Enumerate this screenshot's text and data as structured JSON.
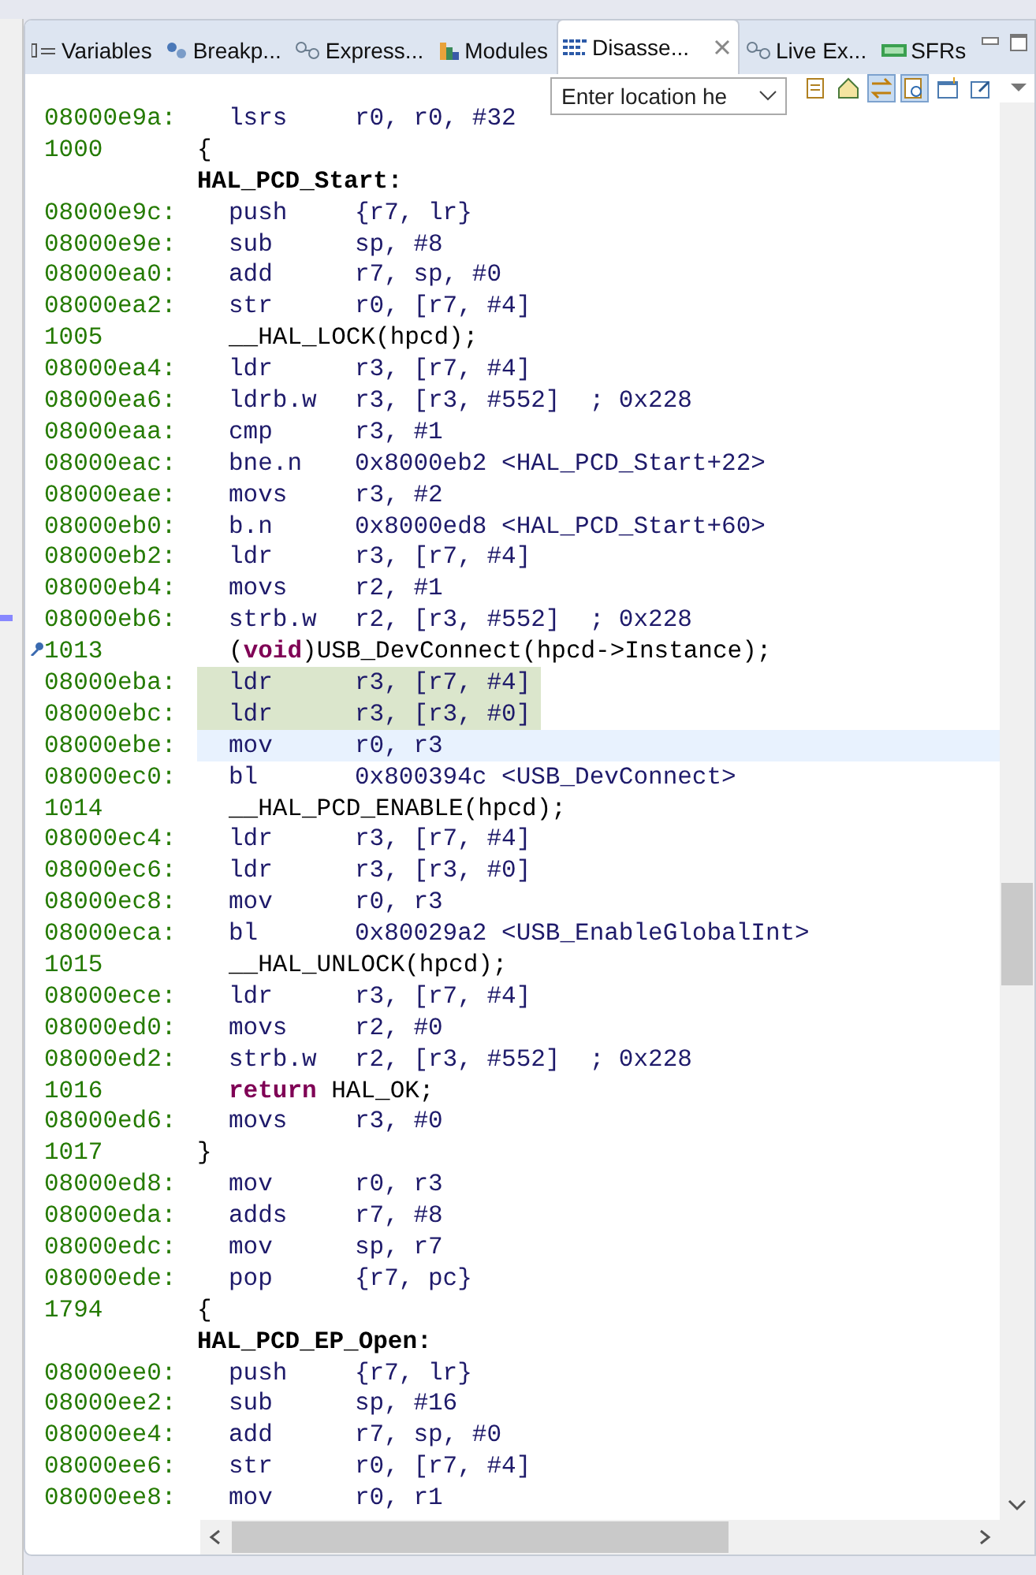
{
  "tabs": [
    {
      "label": "Variables",
      "kind": "variables",
      "selected": false
    },
    {
      "label": "Breakp...",
      "kind": "breakpoints",
      "selected": false
    },
    {
      "label": "Express...",
      "kind": "expressions",
      "selected": false
    },
    {
      "label": "Modules",
      "kind": "modules",
      "selected": false
    },
    {
      "label": "Disasse...",
      "kind": "disassembly",
      "selected": true
    },
    {
      "label": "Live Ex...",
      "kind": "live",
      "selected": false
    },
    {
      "label": "SFRs",
      "kind": "sfr",
      "selected": false
    }
  ],
  "location": {
    "placeholder": "Enter location he"
  },
  "toolbar_buttons": [
    {
      "kind": "document",
      "pressed": false
    },
    {
      "kind": "home",
      "pressed": false
    },
    {
      "kind": "swap",
      "pressed": true
    },
    {
      "kind": "link",
      "pressed": true
    },
    {
      "kind": "new-window",
      "pressed": false
    },
    {
      "kind": "pin",
      "pressed": false
    }
  ],
  "lines": [
    {
      "kind": "instr",
      "address": "08000e9a:",
      "mnemonic": "lsrs",
      "operands": "r0, r0, #32",
      "highlighted": false,
      "current": false
    },
    {
      "kind": "source",
      "number": "1000",
      "text": "{",
      "indented": false,
      "breakpoint": false
    },
    {
      "kind": "label",
      "text": "HAL_PCD_Start:"
    },
    {
      "kind": "instr",
      "address": "08000e9c:",
      "mnemonic": "push",
      "operands": "{r7, lr}",
      "highlighted": false,
      "current": false
    },
    {
      "kind": "instr",
      "address": "08000e9e:",
      "mnemonic": "sub",
      "operands": "sp, #8",
      "highlighted": false,
      "current": false
    },
    {
      "kind": "instr",
      "address": "08000ea0:",
      "mnemonic": "add",
      "operands": "r7, sp, #0",
      "highlighted": false,
      "current": false
    },
    {
      "kind": "instr",
      "address": "08000ea2:",
      "mnemonic": "str",
      "operands": "r0, [r7, #4]",
      "highlighted": false,
      "current": false
    },
    {
      "kind": "source",
      "number": "1005",
      "text": "__HAL_LOCK(hpcd);",
      "indented": true,
      "breakpoint": false
    },
    {
      "kind": "instr",
      "address": "08000ea4:",
      "mnemonic": "ldr",
      "operands": "r3, [r7, #4]",
      "highlighted": false,
      "current": false
    },
    {
      "kind": "instr",
      "address": "08000ea6:",
      "mnemonic": "ldrb.w",
      "operands": "r3, [r3, #552]  ; 0x228",
      "highlighted": false,
      "current": false
    },
    {
      "kind": "instr",
      "address": "08000eaa:",
      "mnemonic": "cmp",
      "operands": "r3, #1",
      "highlighted": false,
      "current": false
    },
    {
      "kind": "instr",
      "address": "08000eac:",
      "mnemonic": "bne.n",
      "operands": "0x8000eb2 <HAL_PCD_Start+22>",
      "highlighted": false,
      "current": false
    },
    {
      "kind": "instr",
      "address": "08000eae:",
      "mnemonic": "movs",
      "operands": "r3, #2",
      "highlighted": false,
      "current": false
    },
    {
      "kind": "instr",
      "address": "08000eb0:",
      "mnemonic": "b.n",
      "operands": "0x8000ed8 <HAL_PCD_Start+60>",
      "highlighted": false,
      "current": false
    },
    {
      "kind": "instr",
      "address": "08000eb2:",
      "mnemonic": "ldr",
      "operands": "r3, [r7, #4]",
      "highlighted": false,
      "current": false
    },
    {
      "kind": "instr",
      "address": "08000eb4:",
      "mnemonic": "movs",
      "operands": "r2, #1",
      "highlighted": false,
      "current": false
    },
    {
      "kind": "instr",
      "address": "08000eb6:",
      "mnemonic": "strb.w",
      "operands": "r2, [r3, #552]  ; 0x228",
      "highlighted": false,
      "current": false
    },
    {
      "kind": "source",
      "number": "1013",
      "text": "(**void**)USB_DevConnect(hpcd->Instance);",
      "indented": true,
      "breakpoint": true
    },
    {
      "kind": "instr",
      "address": "08000eba:",
      "mnemonic": "ldr",
      "operands": "r3, [r7, #4]",
      "highlighted": true,
      "current": false
    },
    {
      "kind": "instr",
      "address": "08000ebc:",
      "mnemonic": "ldr",
      "operands": "r3, [r3, #0]",
      "highlighted": true,
      "current": false
    },
    {
      "kind": "instr",
      "address": "08000ebe:",
      "mnemonic": "mov",
      "operands": "r0, r3",
      "highlighted": false,
      "current": true
    },
    {
      "kind": "instr",
      "address": "08000ec0:",
      "mnemonic": "bl",
      "operands": "0x800394c <USB_DevConnect>",
      "highlighted": false,
      "current": false
    },
    {
      "kind": "source",
      "number": "1014",
      "text": "__HAL_PCD_ENABLE(hpcd);",
      "indented": true,
      "breakpoint": false
    },
    {
      "kind": "instr",
      "address": "08000ec4:",
      "mnemonic": "ldr",
      "operands": "r3, [r7, #4]",
      "highlighted": false,
      "current": false
    },
    {
      "kind": "instr",
      "address": "08000ec6:",
      "mnemonic": "ldr",
      "operands": "r3, [r3, #0]",
      "highlighted": false,
      "current": false
    },
    {
      "kind": "instr",
      "address": "08000ec8:",
      "mnemonic": "mov",
      "operands": "r0, r3",
      "highlighted": false,
      "current": false
    },
    {
      "kind": "instr",
      "address": "08000eca:",
      "mnemonic": "bl",
      "operands": "0x80029a2 <USB_EnableGlobalInt>",
      "highlighted": false,
      "current": false
    },
    {
      "kind": "source",
      "number": "1015",
      "text": "__HAL_UNLOCK(hpcd);",
      "indented": true,
      "breakpoint": false
    },
    {
      "kind": "instr",
      "address": "08000ece:",
      "mnemonic": "ldr",
      "operands": "r3, [r7, #4]",
      "highlighted": false,
      "current": false
    },
    {
      "kind": "instr",
      "address": "08000ed0:",
      "mnemonic": "movs",
      "operands": "r2, #0",
      "highlighted": false,
      "current": false
    },
    {
      "kind": "instr",
      "address": "08000ed2:",
      "mnemonic": "strb.w",
      "operands": "r2, [r3, #552]  ; 0x228",
      "highlighted": false,
      "current": false
    },
    {
      "kind": "source",
      "number": "1016",
      "text": "**return** HAL_OK;",
      "indented": true,
      "breakpoint": false
    },
    {
      "kind": "instr",
      "address": "08000ed6:",
      "mnemonic": "movs",
      "operands": "r3, #0",
      "highlighted": false,
      "current": false
    },
    {
      "kind": "source",
      "number": "1017",
      "text": "}",
      "indented": false,
      "breakpoint": false
    },
    {
      "kind": "instr",
      "address": "08000ed8:",
      "mnemonic": "mov",
      "operands": "r0, r3",
      "highlighted": false,
      "current": false
    },
    {
      "kind": "instr",
      "address": "08000eda:",
      "mnemonic": "adds",
      "operands": "r7, #8",
      "highlighted": false,
      "current": false
    },
    {
      "kind": "instr",
      "address": "08000edc:",
      "mnemonic": "mov",
      "operands": "sp, r7",
      "highlighted": false,
      "current": false
    },
    {
      "kind": "instr",
      "address": "08000ede:",
      "mnemonic": "pop",
      "operands": "{r7, pc}",
      "highlighted": false,
      "current": false
    },
    {
      "kind": "source",
      "number": "1794",
      "text": "{",
      "indented": false,
      "breakpoint": false
    },
    {
      "kind": "label",
      "text": "HAL_PCD_EP_Open:"
    },
    {
      "kind": "instr",
      "address": "08000ee0:",
      "mnemonic": "push",
      "operands": "{r7, lr}",
      "highlighted": false,
      "current": false
    },
    {
      "kind": "instr",
      "address": "08000ee2:",
      "mnemonic": "sub",
      "operands": "sp, #16",
      "highlighted": false,
      "current": false
    },
    {
      "kind": "instr",
      "address": "08000ee4:",
      "mnemonic": "add",
      "operands": "r7, sp, #0",
      "highlighted": false,
      "current": false
    },
    {
      "kind": "instr",
      "address": "08000ee6:",
      "mnemonic": "str",
      "operands": "r0, [r7, #4]",
      "highlighted": false,
      "current": false
    },
    {
      "kind": "instr",
      "address": "08000ee8:",
      "mnemonic": "mov",
      "operands": "r0, r1",
      "highlighted": false,
      "current": false
    }
  ]
}
